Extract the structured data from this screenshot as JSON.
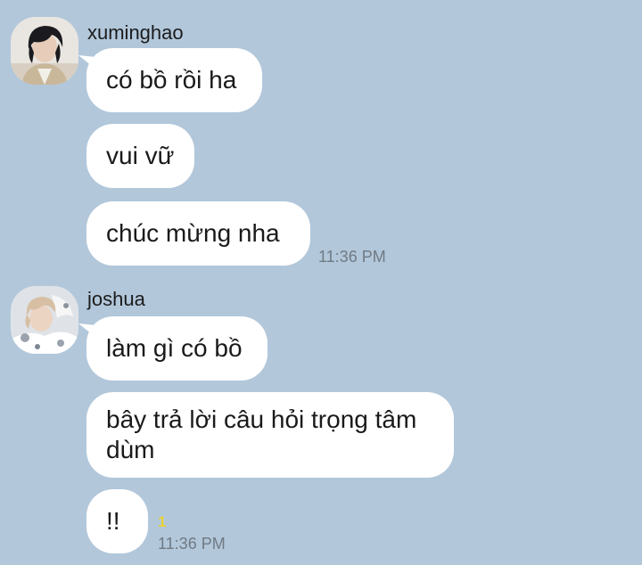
{
  "chat": {
    "background_color": "#b2c7da",
    "groups": [
      {
        "sender": "xuminghao",
        "avatar_icon": "profile-photo-xuminghao",
        "messages": [
          "có bồ rồi ha",
          "vui vữ",
          "chúc mừng nha"
        ],
        "timestamp": "11:36 PM"
      },
      {
        "sender": "joshua",
        "avatar_icon": "profile-photo-joshua",
        "messages": [
          "làm gì có bồ",
          "bây trả lời câu hỏi trọng tâm\ndùm",
          "!!"
        ],
        "timestamp": "11:36 PM",
        "unread_count": "1"
      }
    ]
  }
}
